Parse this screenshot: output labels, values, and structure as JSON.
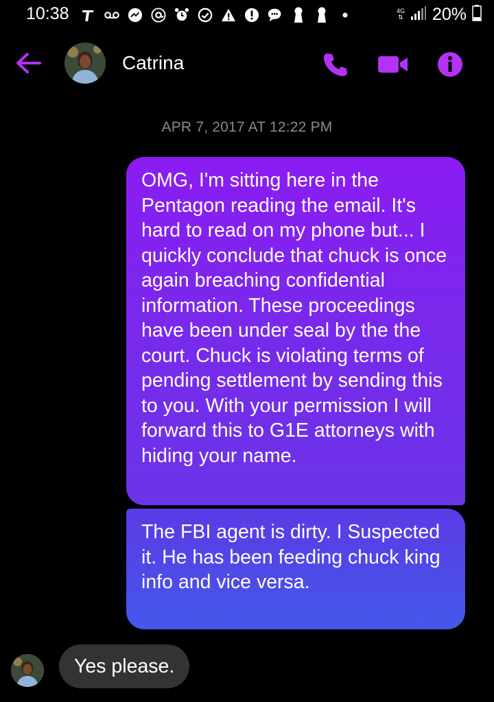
{
  "status_bar": {
    "time": "10:38",
    "battery": "20%",
    "network": "4G",
    "icons": [
      "t-mobile-icon",
      "voicemail-icon",
      "messenger-icon",
      "at-icon",
      "alarm-icon",
      "sync-icon",
      "warning-icon",
      "alert-icon",
      "chat-icon",
      "keyhole-icon",
      "keyhole-icon",
      "dot-icon"
    ]
  },
  "header": {
    "contact_name": "Catrina",
    "accent": "#b432f5"
  },
  "conversation": {
    "timestamp": "APR 7, 2017 AT 12:22 PM",
    "messages": [
      {
        "direction": "outgoing",
        "text": "OMG, I'm sitting here in the Pentagon reading the email. It's hard to read on my phone but... I quickly conclude that chuck is once again breaching confidential information. These proceedings have been under seal by the the court. Chuck is violating terms of pending settlement by sending this to you. With your permission I will forward this to G1E attorneys with hiding your name."
      },
      {
        "direction": "outgoing",
        "text": "The FBI agent is dirty. I Suspected it. He has been feeding chuck king info and vice versa."
      },
      {
        "direction": "incoming",
        "text": "Yes please."
      }
    ]
  },
  "colors": {
    "background": "#000000",
    "bubble_top": "#8b1cf2",
    "bubble_bottom": "#4358ea",
    "incoming_bubble": "#333333",
    "timestamp": "#8a8a8a"
  }
}
